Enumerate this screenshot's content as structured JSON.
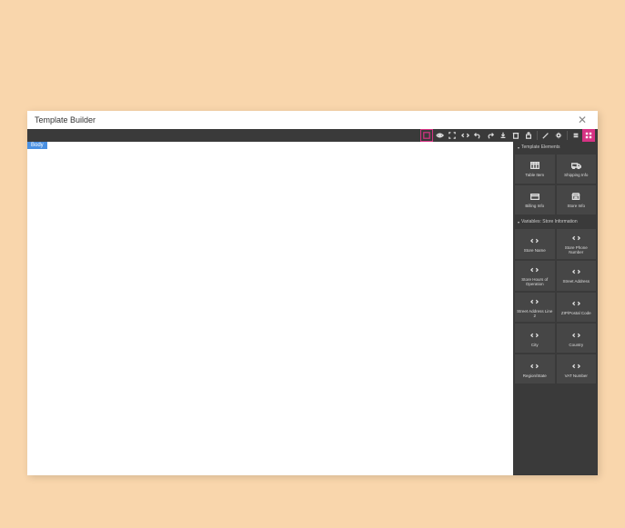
{
  "window": {
    "title": "Template Builder"
  },
  "canvas": {
    "bodyTag": "Body"
  },
  "sections": {
    "templateElements": {
      "title": "Template Elements",
      "blocks": [
        {
          "icon": "table",
          "label": "Table Item"
        },
        {
          "icon": "truck",
          "label": "Shipping Info"
        },
        {
          "icon": "card",
          "label": "Billing Info"
        },
        {
          "icon": "store",
          "label": "Store Info"
        }
      ]
    },
    "storeVars": {
      "title": "Variables: Store Information",
      "blocks": [
        {
          "label": "Store Name"
        },
        {
          "label": "Store Phone Number"
        },
        {
          "label": "Store Hours of Operation"
        },
        {
          "label": "Street Address"
        },
        {
          "label": "Street Address Line 2"
        },
        {
          "label": "ZIP/Postal Code"
        },
        {
          "label": "City"
        },
        {
          "label": "Country"
        },
        {
          "label": "Region/State"
        },
        {
          "label": "VAT Number"
        }
      ]
    }
  }
}
